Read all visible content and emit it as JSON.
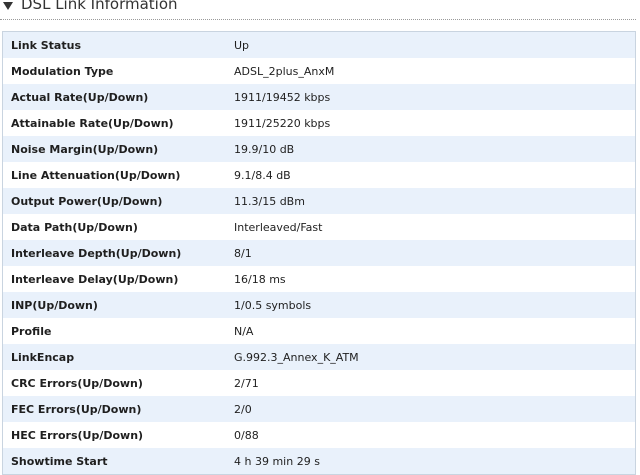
{
  "section": {
    "title": "DSL Link Information",
    "toggle_icon": "triangle-down-icon"
  },
  "rows": [
    {
      "label": "Link Status",
      "value": "Up"
    },
    {
      "label": "Modulation Type",
      "value": "ADSL_2plus_AnxM"
    },
    {
      "label": "Actual Rate(Up/Down)",
      "value": "1911/19452 kbps"
    },
    {
      "label": "Attainable Rate(Up/Down)",
      "value": "1911/25220 kbps"
    },
    {
      "label": "Noise Margin(Up/Down)",
      "value": "19.9/10 dB"
    },
    {
      "label": "Line Attenuation(Up/Down)",
      "value": "9.1/8.4 dB"
    },
    {
      "label": "Output Power(Up/Down)",
      "value": "11.3/15 dBm"
    },
    {
      "label": "Data Path(Up/Down)",
      "value": "Interleaved/Fast"
    },
    {
      "label": "Interleave Depth(Up/Down)",
      "value": "8/1"
    },
    {
      "label": "Interleave Delay(Up/Down)",
      "value": "16/18 ms"
    },
    {
      "label": "INP(Up/Down)",
      "value": "1/0.5 symbols"
    },
    {
      "label": "Profile",
      "value": "N/A"
    },
    {
      "label": "LinkEncap",
      "value": "G.992.3_Annex_K_ATM"
    },
    {
      "label": "CRC Errors(Up/Down)",
      "value": "2/71"
    },
    {
      "label": "FEC Errors(Up/Down)",
      "value": "2/0"
    },
    {
      "label": "HEC Errors(Up/Down)",
      "value": "0/88"
    },
    {
      "label": "Showtime Start",
      "value": "4 h 39 min 29 s"
    }
  ],
  "colors": {
    "row_alt": "#e9f1fb",
    "row_plain": "#ffffff",
    "border": "#c9d4e0"
  }
}
